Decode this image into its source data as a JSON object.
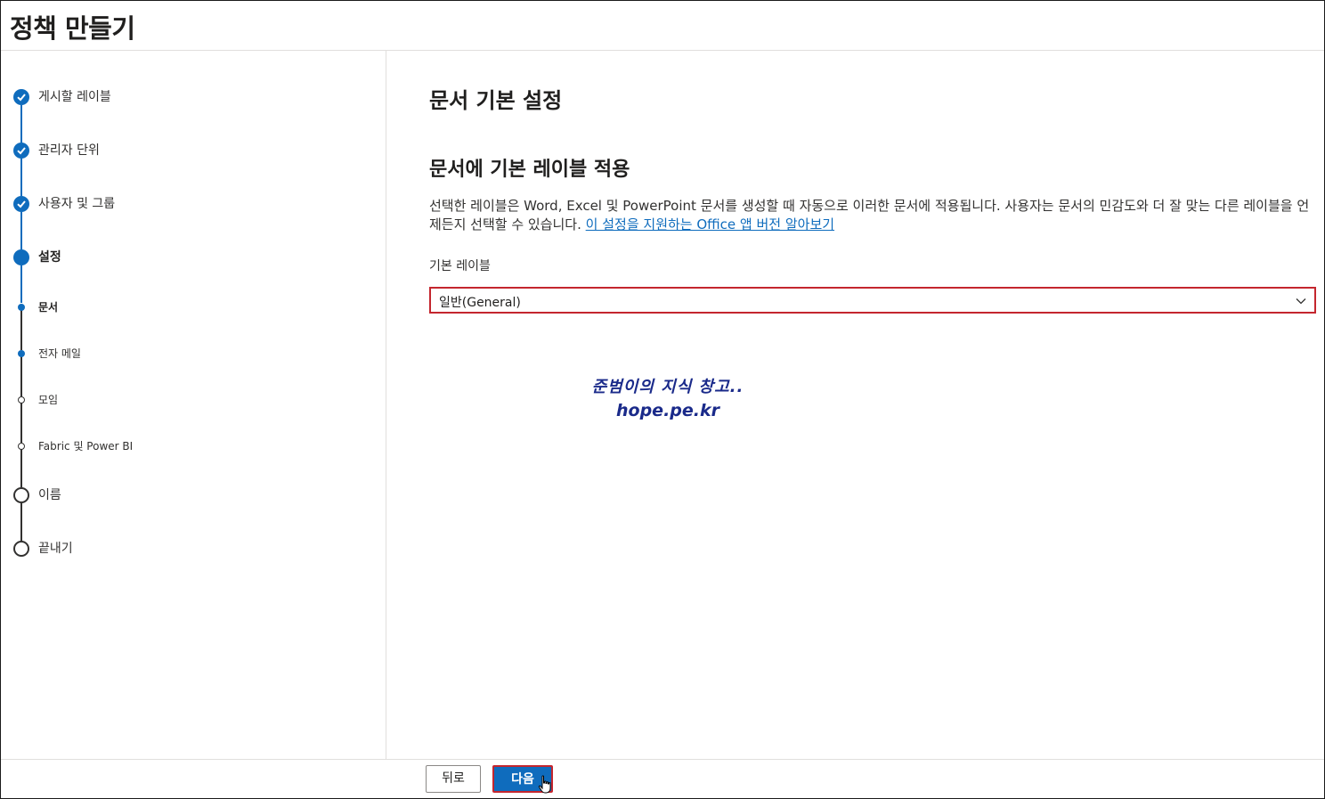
{
  "header": {
    "title": "정책 만들기"
  },
  "nav": {
    "steps": [
      {
        "label": "게시할 레이블",
        "state": "done"
      },
      {
        "label": "관리자 단위",
        "state": "done"
      },
      {
        "label": "사용자 및 그룹",
        "state": "done"
      },
      {
        "label": "설정",
        "state": "current"
      },
      {
        "label": "문서",
        "state": "sub-current"
      },
      {
        "label": "전자 메일",
        "state": "sub-upcoming"
      },
      {
        "label": "모임",
        "state": "sub-upcoming"
      },
      {
        "label": "Fabric 및 Power BI",
        "state": "sub-upcoming"
      },
      {
        "label": "이름",
        "state": "upcoming"
      },
      {
        "label": "끝내기",
        "state": "upcoming"
      }
    ]
  },
  "main": {
    "heading": "문서 기본 설정",
    "subheading": "문서에 기본 레이블 적용",
    "description": "선택한 레이블은 Word, Excel 및 PowerPoint 문서를 생성할 때 자동으로 이러한 문서에 적용됩니다. 사용자는 문서의 민감도와 더 잘 맞는 다른 레이블을 언제든지 선택할 수 있습니다. ",
    "learn_more_link": "이 설정을 지원하는 Office 앱 버전 알아보기",
    "field_label": "기본 레이블",
    "selected_value": "일반(General)"
  },
  "watermark": {
    "line1": "준범이의 지식 창고..",
    "line2": "hope.pe.kr"
  },
  "footer": {
    "back_label": "뒤로",
    "next_label": "다음"
  },
  "colors": {
    "accent": "#0f6cbd",
    "highlight_border": "#c4262e"
  }
}
